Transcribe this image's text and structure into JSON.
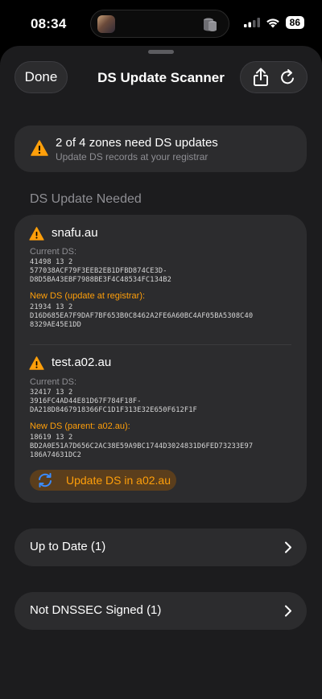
{
  "status_bar": {
    "time": "08:34",
    "battery": "86"
  },
  "nav": {
    "done_label": "Done",
    "title": "DS Update Scanner"
  },
  "banner": {
    "title": "2 of 4 zones need DS updates",
    "subtitle": "Update DS records at your registrar"
  },
  "section_header": "DS Update Needed",
  "zones": [
    {
      "name": "snafu.au",
      "current_label": "Current DS:",
      "current_lines": [
        "41498 13 2",
        "577038ACF79F3EEB2EB1DFBD874CE3D-",
        "D8D5BA43EBF7988BE3F4C48534FC134B2"
      ],
      "new_label": "New DS (update at registrar):",
      "new_lines": [
        "21934 13 2",
        "D16D685EA7F9DAF7BF653B0C8462A2FE6A60BC4AF05BA5308C40",
        "8329AE45E1DD"
      ]
    },
    {
      "name": "test.a02.au",
      "current_label": "Current DS:",
      "current_lines": [
        "32417 13 2",
        "3916FC4AD44E81D67F784F18F-",
        "DA218D8467918366FC1D1F313E32E650F612F1F"
      ],
      "new_label": "New DS (parent: a02.au):",
      "new_lines": [
        "18619 13 2",
        "BD2A0E51A7D656C2AC38E59A9BC1744D3024831D6FED73233E97",
        "186A74631DC2"
      ],
      "action_label": "Update DS in a02.au"
    }
  ],
  "rows": [
    {
      "label": "Up to Date (1)"
    },
    {
      "label": "Not DNSSEC Signed (1)"
    }
  ],
  "colors": {
    "accent_orange": "#ff9f0a",
    "card_bg": "#2c2c2e",
    "sheet_bg": "#1c1c1e"
  }
}
